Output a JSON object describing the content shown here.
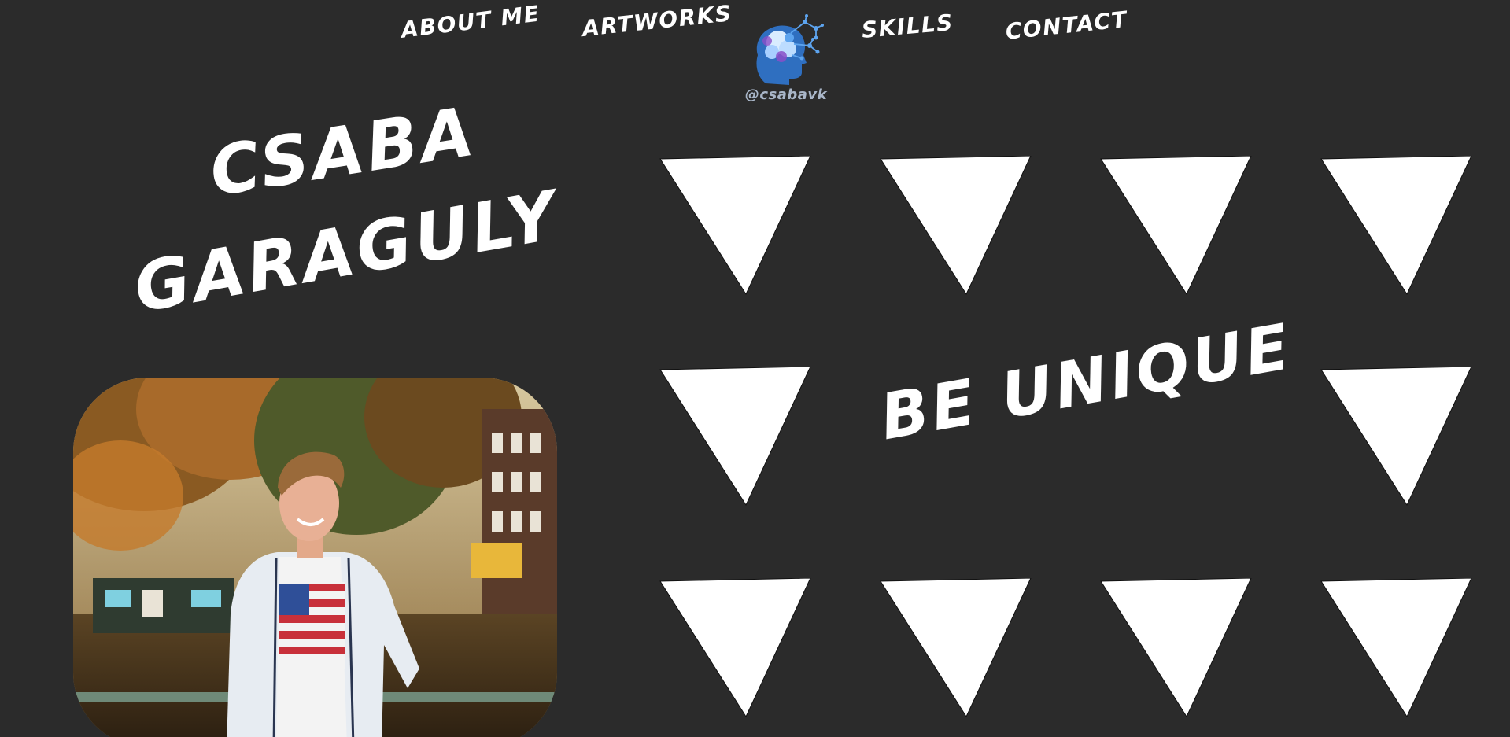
{
  "nav": {
    "about_label": "About me",
    "artworks_label": "Artworks",
    "skills_label": "Skills",
    "contact_label": "Contact",
    "logo_caption": "@csabavk"
  },
  "hero": {
    "first_name": "Csaba",
    "last_name": "Garaguly",
    "slogan": "Be unique"
  },
  "colors": {
    "background": "#2b2b2b",
    "text": "#ffffff",
    "triangle_fill": "#ffffff",
    "logo_blue": "#2f7fd0",
    "logo_purple": "#8a4fc8"
  },
  "icons": {
    "logo": "brain-network-head-icon",
    "photo": "profile-photo"
  }
}
